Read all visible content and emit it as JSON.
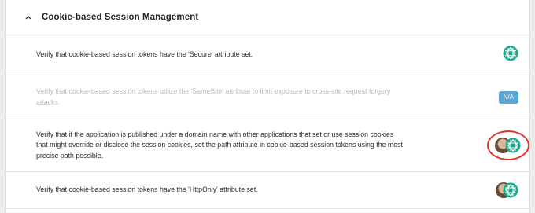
{
  "section": {
    "title": "Cookie-based Session Management",
    "expanded_icon": "chevron-up-icon"
  },
  "rows": [
    {
      "text": "Verify that cookie-based session tokens have the 'Secure' attribute set.",
      "status": "teal-logo-icon",
      "dimmed": false
    },
    {
      "text": "Verify that cookie-based session tokens utilize the 'SameSite' attribute to limit exposure to cross-site request forgery attacks.",
      "status_label": "N/A",
      "dimmed": true
    },
    {
      "text": "Verify that if the application is published under a domain name with other applications that set or use session cookies that might override or disclose the session cookies, set the path attribute in cookie-based session tokens using the most precise path possible.",
      "status": "avatar-with-teal-logo",
      "highlighted": true
    },
    {
      "text": "Verify that cookie-based session tokens have the 'HttpOnly' attribute set.",
      "status": "avatar-with-teal-logo"
    }
  ],
  "colors": {
    "teal": "#18a88a",
    "na_badge": "#5aa7d6",
    "highlight_ring": "#e4332b",
    "dim_text": "#b9b9b9"
  }
}
